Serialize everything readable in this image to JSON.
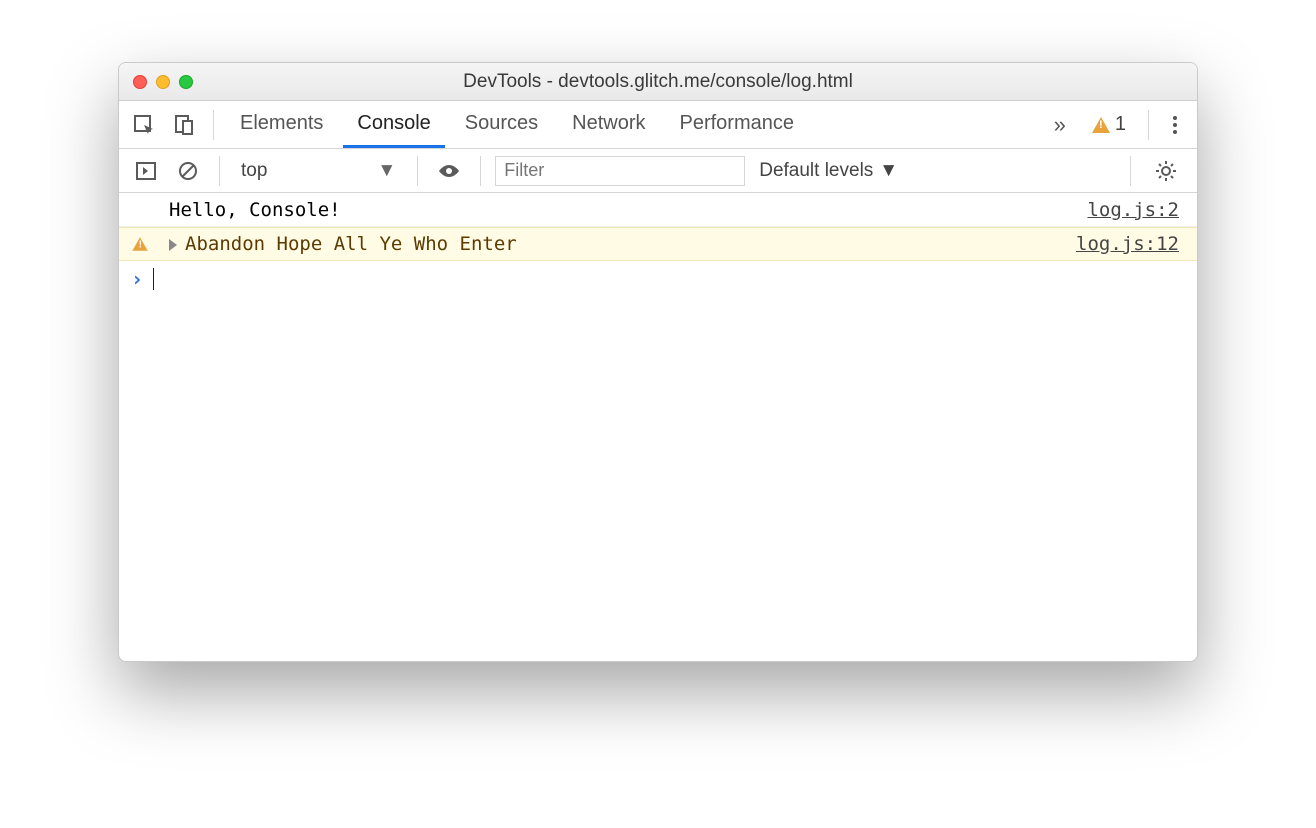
{
  "window": {
    "title": "DevTools - devtools.glitch.me/console/log.html"
  },
  "tabs": {
    "items": [
      "Elements",
      "Console",
      "Sources",
      "Network",
      "Performance"
    ],
    "active_index": 1,
    "overflow_glyph": "»",
    "warning_count": "1"
  },
  "toolbar": {
    "context_label": "top",
    "filter_placeholder": "Filter",
    "levels_label": "Default levels"
  },
  "console": {
    "entries": [
      {
        "type": "log",
        "message": "Hello, Console!",
        "source": "log.js:2"
      },
      {
        "type": "warn",
        "message": "Abandon Hope All Ye Who Enter",
        "source": "log.js:12"
      }
    ],
    "prompt_glyph": "›"
  }
}
